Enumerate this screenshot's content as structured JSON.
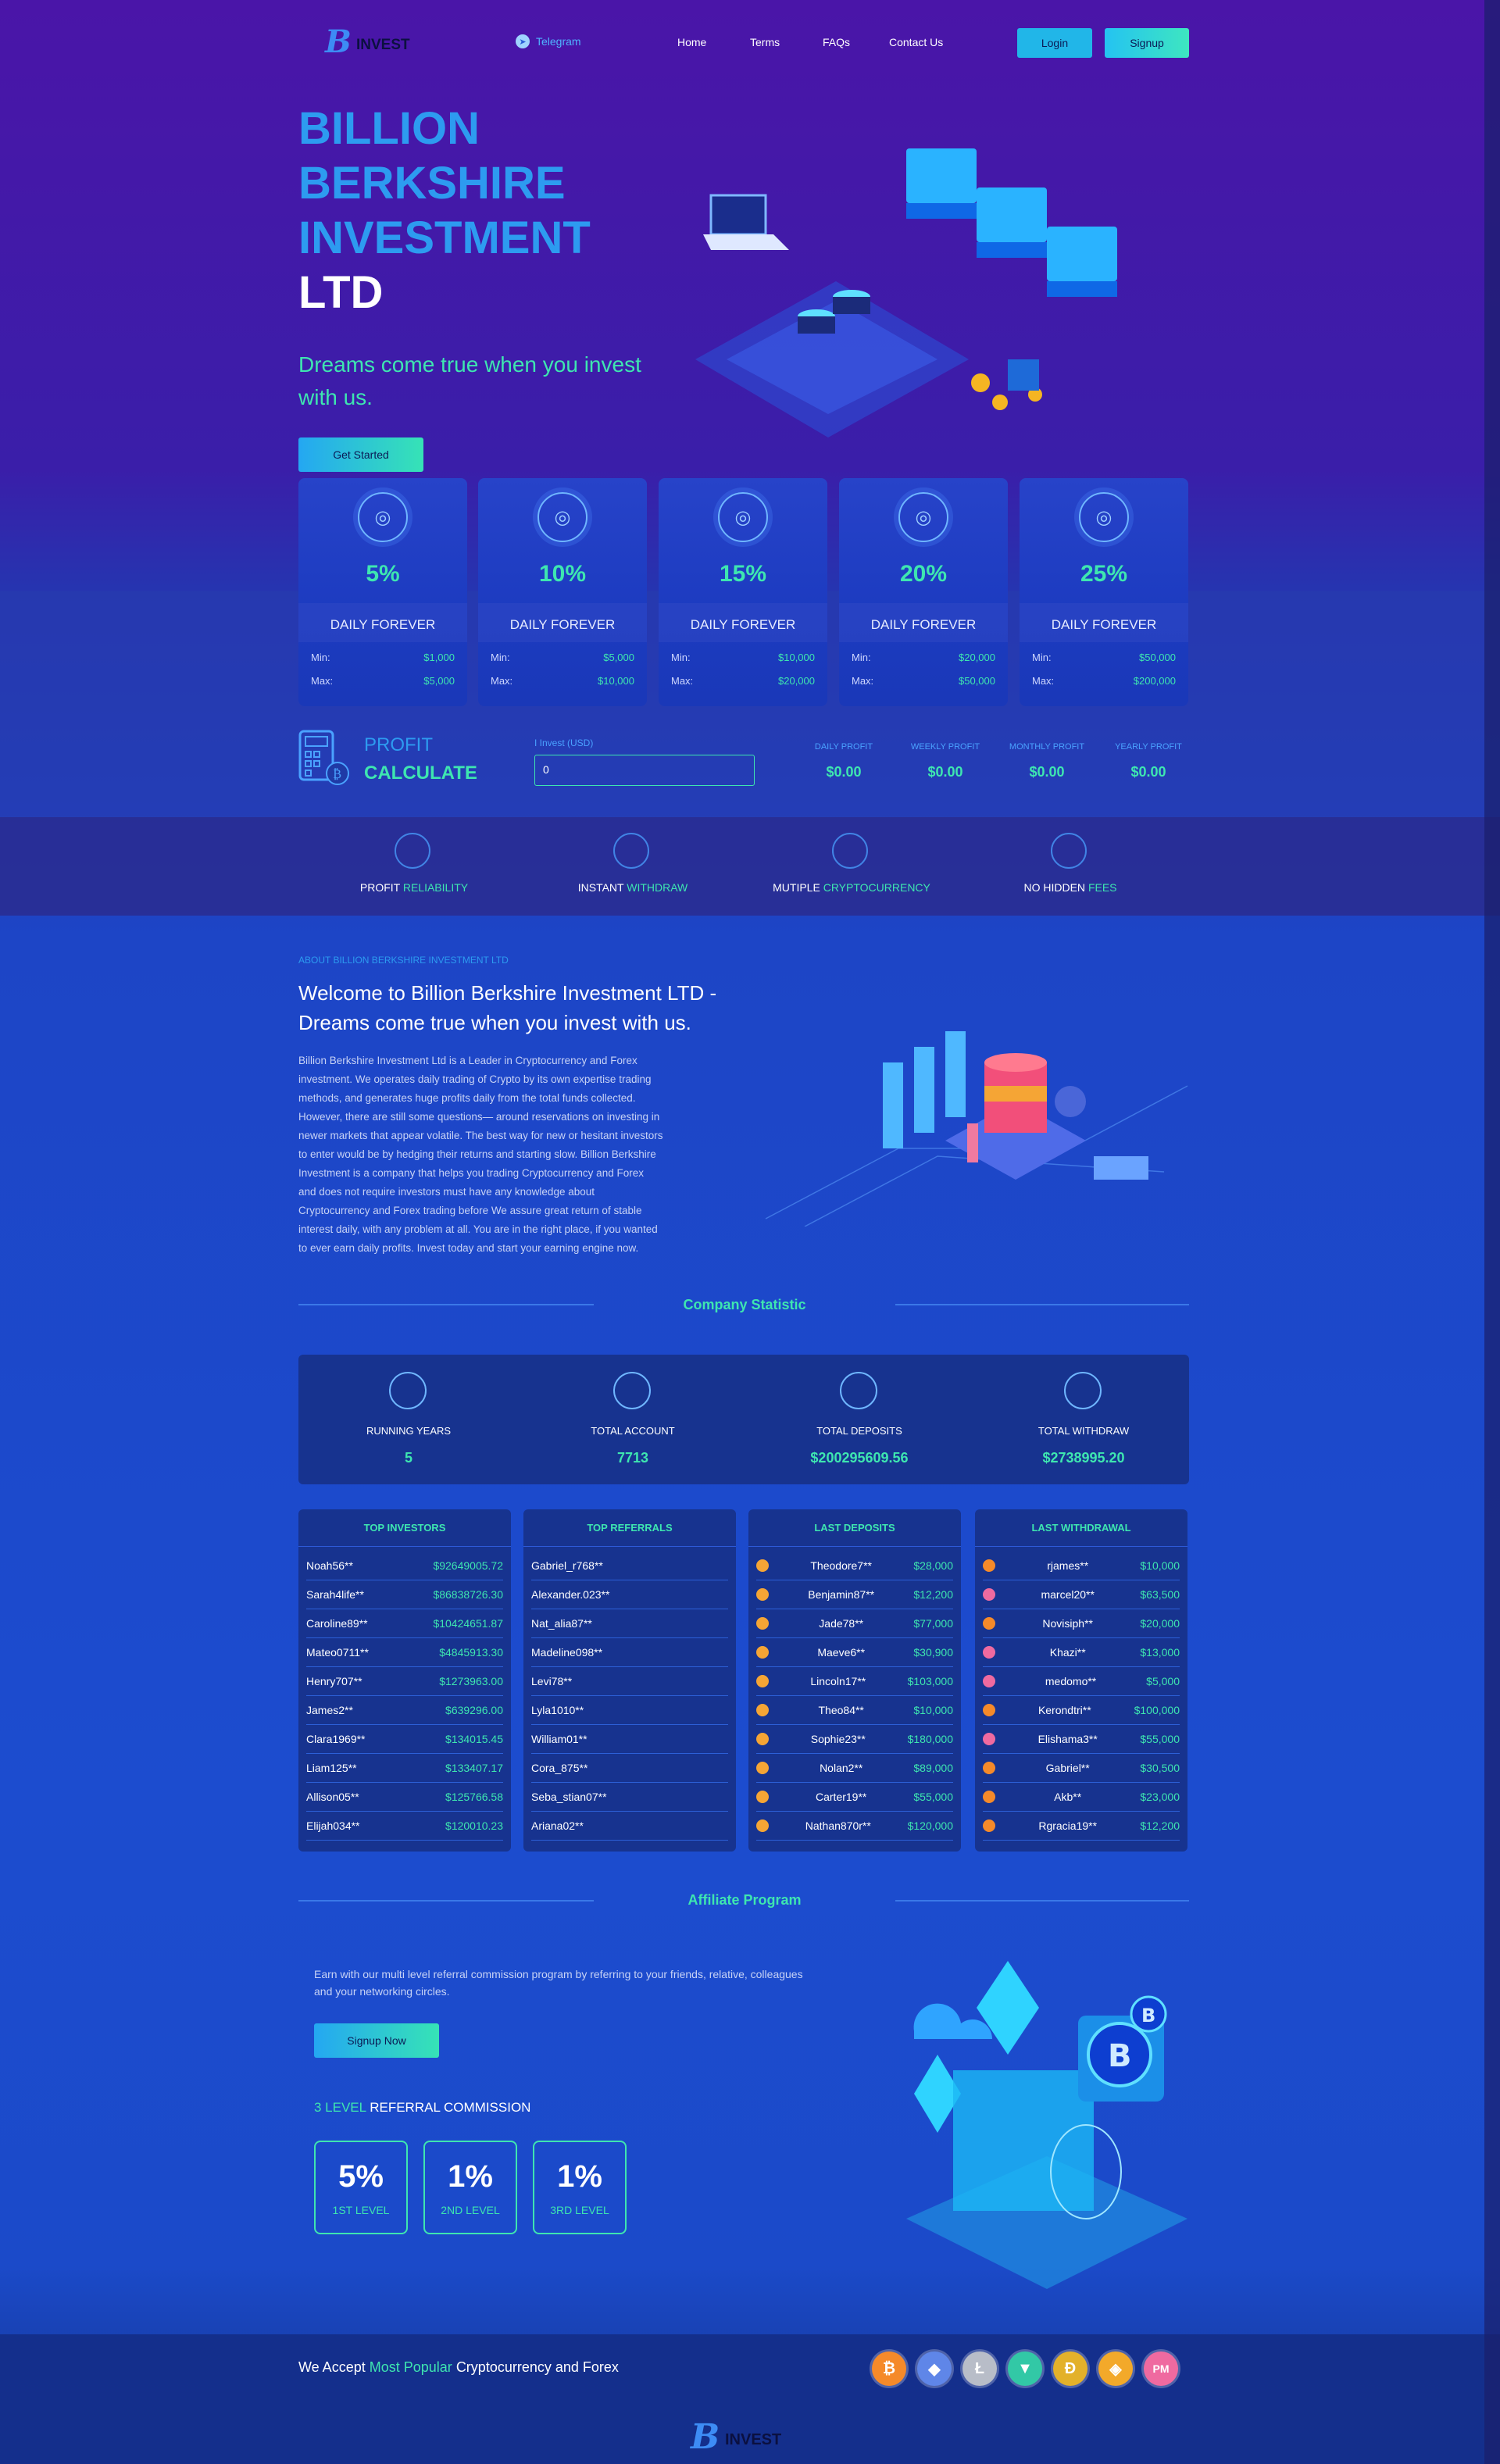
{
  "header": {
    "logo": "INVEST",
    "telegram": "Telegram",
    "nav": [
      "Home",
      "Terms",
      "FAQs",
      "Contact Us"
    ],
    "login": "Login",
    "signup": "Signup"
  },
  "hero": {
    "title_lines": [
      "BILLION",
      "BERKSHIRE",
      "INVESTMENT"
    ],
    "title_last": "LTD",
    "tagline": "Dreams come true when you invest with us.",
    "cta": "Get Started"
  },
  "plans": [
    {
      "rate": "5%",
      "label": "DAILY FOREVER",
      "min_label": "Min:",
      "min": "$1,000",
      "max_label": "Max:",
      "max": "$5,000",
      "icon": "bank-card-icon"
    },
    {
      "rate": "10%",
      "label": "DAILY FOREVER",
      "min_label": "Min:",
      "min": "$5,000",
      "max_label": "Max:",
      "max": "$10,000",
      "icon": "bitcoin-safe-icon"
    },
    {
      "rate": "15%",
      "label": "DAILY FOREVER",
      "min_label": "Min:",
      "min": "$10,000",
      "max_label": "Max:",
      "max": "$20,000",
      "icon": "monitor-chart-icon"
    },
    {
      "rate": "20%",
      "label": "DAILY FOREVER",
      "min_label": "Min:",
      "min": "$20,000",
      "max_label": "Max:",
      "max": "$50,000",
      "icon": "bitcoin-network-icon"
    },
    {
      "rate": "25%",
      "label": "DAILY FOREVER",
      "min_label": "Min:",
      "min": "$50,000",
      "max_label": "Max:",
      "max": "$200,000",
      "icon": "mining-rig-icon"
    }
  ],
  "calc": {
    "title1": "PROFIT",
    "title2": "CALCULATE",
    "input_label": "I Invest (USD)",
    "input_value": "0",
    "outputs": [
      {
        "label": "DAILY PROFIT",
        "value": "$0.00"
      },
      {
        "label": "WEEKLY PROFIT",
        "value": "$0.00"
      },
      {
        "label": "MONTHLY PROFIT",
        "value": "$0.00"
      },
      {
        "label": "YEARLY PROFIT",
        "value": "$0.00"
      }
    ]
  },
  "features": [
    {
      "a": "PROFIT",
      "b": "RELIABILITY",
      "icon": "growth-chart-icon"
    },
    {
      "a": "INSTANT",
      "b": "WITHDRAW",
      "icon": "hand-coin-icon"
    },
    {
      "a": "MUTIPLE",
      "b": "CRYPTOCURRENCY",
      "icon": "globe-bitcoin-icon"
    },
    {
      "a": "NO HIDDEN",
      "b": "FEES",
      "icon": "hand-stop-icon"
    }
  ],
  "about": {
    "kicker": "ABOUT BILLION BERKSHIRE INVESTMENT LTD",
    "heading_l1": "Welcome to Billion Berkshire Investment LTD -",
    "heading_l2": "Dreams come true when you invest with us.",
    "body": [
      "Billion Berkshire Investment Ltd is a Leader in Cryptocurrency and Forex",
      "investment. We operates daily trading of Crypto by its own expertise trading",
      "methods, and generates huge profits daily from the total funds collected.",
      "However, there are still some questions— around reservations on investing in",
      "newer markets that appear volatile. The best way for new or hesitant investors",
      "to enter would be by hedging their returns and starting slow. Billion Berkshire",
      "Investment is a company that helps you trading Cryptocurrency and Forex",
      "and does not require investors must have any knowledge about",
      "Cryptocurrency and Forex trading before We assure great return of stable",
      "interest daily, with any problem at all. You are in the right place, if you wanted",
      "to ever earn daily profits. Invest today and start your earning engine now."
    ]
  },
  "stats": {
    "title": "Company Statistic",
    "items": [
      {
        "label": "RUNNING YEARS",
        "value": "5",
        "icon": "stopwatch-icon"
      },
      {
        "label": "TOTAL ACCOUNT",
        "value": "7713",
        "icon": "users-network-icon"
      },
      {
        "label": "TOTAL DEPOSITS",
        "value": "$200295609.56",
        "icon": "chart-up-icon"
      },
      {
        "label": "TOTAL WITHDRAW",
        "value": "$2738995.20",
        "icon": "coins-exchange-icon"
      }
    ]
  },
  "top_investors": {
    "title": "TOP INVESTORS",
    "rows": [
      [
        "Noah56**",
        "$92649005.72"
      ],
      [
        "Sarah4life**",
        "$86838726.30"
      ],
      [
        "Caroline89**",
        "$10424651.87"
      ],
      [
        "Mateo0711**",
        "$4845913.30"
      ],
      [
        "Henry707**",
        "$1273963.00"
      ],
      [
        "James2**",
        "$639296.00"
      ],
      [
        "Clara1969**",
        "$134015.45"
      ],
      [
        "Liam125**",
        "$133407.17"
      ],
      [
        "Allison05**",
        "$125766.58"
      ],
      [
        "Elijah034**",
        "$120010.23"
      ]
    ]
  },
  "top_referrals": {
    "title": "TOP REFERRALS",
    "rows": [
      "Gabriel_r768**",
      "Alexander.023**",
      "Nat_alia87**",
      "Madeline098**",
      "Levi78**",
      "Lyla1010**",
      "William01**",
      "Cora_875**",
      "Seba_stian07**",
      "Ariana02**"
    ]
  },
  "last_deposits": {
    "title": "LAST DEPOSITS",
    "rows": [
      [
        "Theodore7**",
        "$28,000"
      ],
      [
        "Benjamin87**",
        "$12,200"
      ],
      [
        "Jade78**",
        "$77,000"
      ],
      [
        "Maeve6**",
        "$30,900"
      ],
      [
        "Lincoln17**",
        "$103,000"
      ],
      [
        "Theo84**",
        "$10,000"
      ],
      [
        "Sophie23**",
        "$180,000"
      ],
      [
        "Nolan2**",
        "$89,000"
      ],
      [
        "Carter19**",
        "$55,000"
      ],
      [
        "Nathan870r**",
        "$120,000"
      ]
    ]
  },
  "last_withdrawal": {
    "title": "LAST WITHDRAWAL",
    "rows": [
      [
        "rjames**",
        "$10,000"
      ],
      [
        "marcel20**",
        "$63,500"
      ],
      [
        "Novisiph**",
        "$20,000"
      ],
      [
        "Khazi**",
        "$13,000"
      ],
      [
        "medomo**",
        "$5,000"
      ],
      [
        "Kerondtri**",
        "$100,000"
      ],
      [
        "Elishama3**",
        "$55,000"
      ],
      [
        "Gabriel**",
        "$30,500"
      ],
      [
        "Akb**",
        "$23,000"
      ],
      [
        "Rgracia19**",
        "$12,200"
      ]
    ]
  },
  "affiliate": {
    "title": "Affiliate Program",
    "text_l1": "Earn with our multi level referral commission program by referring to your friends, relative, colleagues",
    "text_l2": "and your networking circles.",
    "cta": "Signup Now",
    "levels_a": "3 LEVEL",
    "levels_b": "REFERRAL COMMISSION",
    "levels": [
      {
        "p": "5%",
        "l": "1ST LEVEL"
      },
      {
        "p": "1%",
        "l": "2ND LEVEL"
      },
      {
        "p": "1%",
        "l": "3RD LEVEL"
      }
    ]
  },
  "accept": {
    "a": "We Accept",
    "b": "Most Popular",
    "c": "Cryptocurrency and Forex",
    "coins": [
      {
        "s": "₿",
        "icon": "bitcoin-icon",
        "color": "#f58a2a"
      },
      {
        "s": "◆",
        "icon": "ethereum-icon",
        "color": "#5f86e8"
      },
      {
        "s": "Ł",
        "icon": "litecoin-icon",
        "color": "#b8bdc8"
      },
      {
        "s": "▼",
        "icon": "tron-icon",
        "color": "#32c8a6"
      },
      {
        "s": "Ð",
        "icon": "dogecoin-icon",
        "color": "#e3b12a"
      },
      {
        "s": "◈",
        "icon": "bnb-icon",
        "color": "#f3a92a"
      },
      {
        "s": "PM",
        "icon": "perfect-money-icon",
        "color": "#ef6aa0"
      }
    ]
  },
  "footer": {
    "logo": "INVEST"
  }
}
